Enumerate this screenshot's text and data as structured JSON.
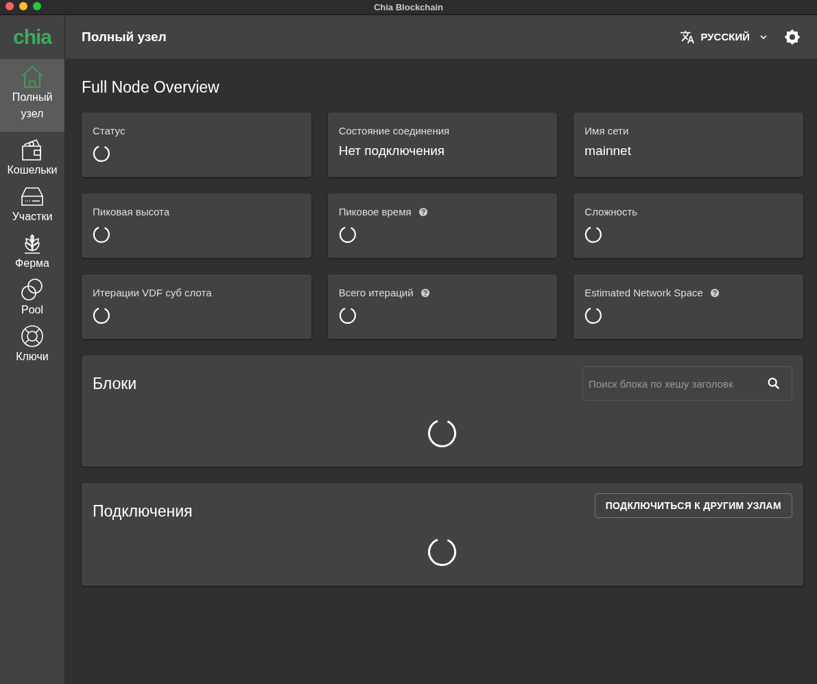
{
  "window": {
    "title": "Chia Blockchain"
  },
  "sidebar": {
    "logo": "chia",
    "items": [
      {
        "kind": "home",
        "label": "Полный узел",
        "selected": true
      },
      {
        "kind": "wallet",
        "label": "Кошельки",
        "selected": false
      },
      {
        "kind": "drive",
        "label": "Участки",
        "selected": false
      },
      {
        "kind": "plant",
        "label": "Ферма",
        "selected": false
      },
      {
        "kind": "rings",
        "label": "Pool",
        "selected": false
      },
      {
        "kind": "lifebuoy",
        "label": "Ключи",
        "selected": false
      }
    ]
  },
  "header": {
    "title": "Полный узел",
    "language": "РУССКИЙ"
  },
  "overview": {
    "title": "Full Node Overview",
    "cards": [
      {
        "label": "Статус",
        "kind": "loading",
        "help": false
      },
      {
        "label": "Состояние соединения",
        "kind": "text",
        "value": "Нет подключения",
        "help": false
      },
      {
        "label": "Имя сети",
        "kind": "text",
        "value": "mainnet",
        "help": false
      },
      {
        "label": "Пиковая высота",
        "kind": "loading",
        "help": false
      },
      {
        "label": "Пиковое время",
        "kind": "loading",
        "help": true
      },
      {
        "label": "Сложность",
        "kind": "loading",
        "help": false
      },
      {
        "label": "Итерации VDF суб слота",
        "kind": "loading",
        "help": false
      },
      {
        "label": "Всего итераций",
        "kind": "loading",
        "help": true
      },
      {
        "label": "Estimated Network Space",
        "kind": "loading",
        "help": true
      }
    ]
  },
  "blocks": {
    "title": "Блоки",
    "search": {
      "placeholder": "Поиск блока по хешу заголовк"
    }
  },
  "connections": {
    "title": "Подключения",
    "button": "ПОДКЛЮЧИТЬСЯ К ДРУГИМ УЗЛАМ"
  }
}
